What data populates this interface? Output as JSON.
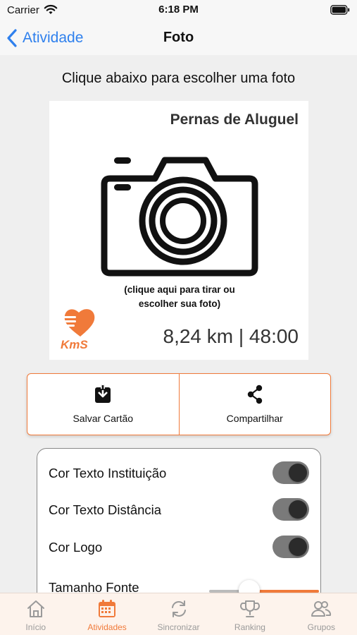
{
  "status_bar": {
    "carrier": "Carrier",
    "time": "6:18 PM"
  },
  "nav": {
    "back_label": "Atividade",
    "title": "Foto"
  },
  "instruction": "Clique abaixo para escolher uma foto",
  "card": {
    "institution": "Pernas de Aluguel",
    "hint_line1": "(clique aqui para tirar ou",
    "hint_line2": "escolher sua foto)",
    "logo_text": "KmS",
    "stats": "8,24 km | 48:00"
  },
  "actions": [
    {
      "label": "Salvar Cartão",
      "icon": "download-icon"
    },
    {
      "label": "Compartilhar",
      "icon": "share-icon"
    }
  ],
  "settings": {
    "toggles": [
      {
        "label": "Cor Texto Instituição",
        "on": true
      },
      {
        "label": "Cor Texto Distância",
        "on": true
      },
      {
        "label": "Cor Logo",
        "on": true
      }
    ],
    "font_size": {
      "label": "Tamanho Fonte",
      "value": 0.4
    }
  },
  "tabs": [
    {
      "label": "Início",
      "icon": "home-icon",
      "active": false
    },
    {
      "label": "Atividades",
      "icon": "calendar-icon",
      "active": true
    },
    {
      "label": "Sincronizar",
      "icon": "sync-icon",
      "active": false
    },
    {
      "label": "Ranking",
      "icon": "trophy-icon",
      "active": false
    },
    {
      "label": "Grupos",
      "icon": "people-icon",
      "active": false
    }
  ],
  "colors": {
    "accent": "#f07a3a",
    "link": "#2f80ed",
    "toggle_track": "#7a7a7a",
    "toggle_knob": "#2b2b2b"
  }
}
